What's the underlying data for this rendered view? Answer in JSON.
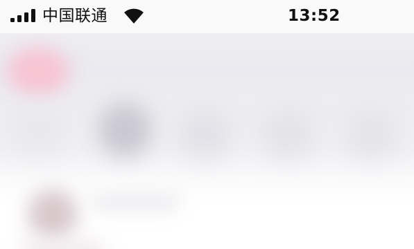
{
  "status_bar": {
    "carrier": "中国联通",
    "time": "13:52",
    "signal_icon": "signal-bars-icon",
    "wifi_icon": "wifi-icon"
  },
  "colors": {
    "status_bar_bg": "#f9f9fa",
    "text": "#111111",
    "blur_accent": "#f7c3d3"
  }
}
